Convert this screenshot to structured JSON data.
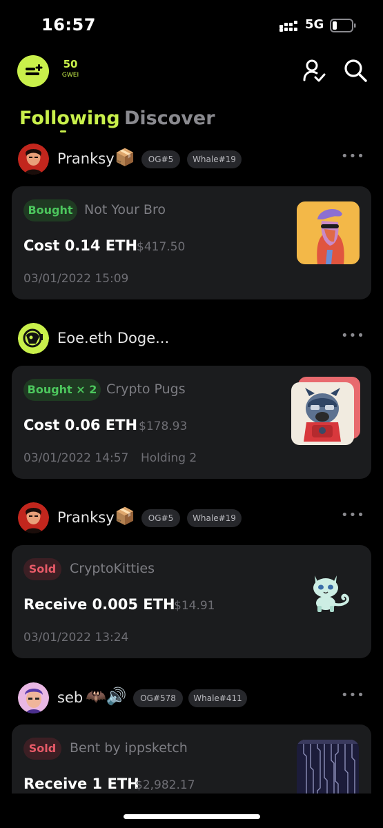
{
  "status_bar": {
    "time": "16:57",
    "network": "5G"
  },
  "header": {
    "gas_value": "50",
    "gas_unit": "GWEI",
    "logo_icon": "wallet-plus-icon",
    "profile_icon": "user-check-icon",
    "search_icon": "search-icon"
  },
  "tabs": [
    {
      "label": "Following",
      "active": true
    },
    {
      "label": "Discover",
      "active": false
    }
  ],
  "feed": [
    {
      "user": {
        "name": "Pranksy",
        "badge": "📦",
        "tags": [
          "OG#5",
          "Whale#19"
        ]
      },
      "card": {
        "action": "Bought",
        "collection": "Not Your Bro",
        "amount": "Cost 0.14 ETH",
        "usd": "$417.50",
        "timestamp": "03/01/2022 15:09",
        "extra": ""
      }
    },
    {
      "user": {
        "name": "Eoe.eth Doge...",
        "badge": "",
        "tags": []
      },
      "card": {
        "action": "Bought × 2",
        "collection": "Crypto Pugs",
        "amount": "Cost 0.06 ETH",
        "usd": "$178.93",
        "timestamp": "03/01/2022 14:57",
        "extra": "Holding 2"
      }
    },
    {
      "user": {
        "name": "Pranksy",
        "badge": "📦",
        "tags": [
          "OG#5",
          "Whale#19"
        ]
      },
      "card": {
        "action": "Sold",
        "collection": "CryptoKitties",
        "amount": "Receive 0.005 ETH",
        "usd": "$14.91",
        "timestamp": "03/01/2022 13:24",
        "extra": ""
      }
    },
    {
      "user": {
        "name": "seb",
        "badge": "🦇🔊",
        "tags": [
          "OG#578",
          "Whale#411"
        ]
      },
      "card": {
        "action": "Sold",
        "collection": "Bent by ippsketch",
        "amount": "Receive 1 ETH",
        "usd": "$2,982.17",
        "timestamp": "",
        "extra": ""
      }
    }
  ],
  "colors": {
    "accent": "#c9f04b",
    "bought": "#4cc75d",
    "sold": "#e85a68",
    "card_bg": "#1b1c1e",
    "bg": "#000000"
  }
}
